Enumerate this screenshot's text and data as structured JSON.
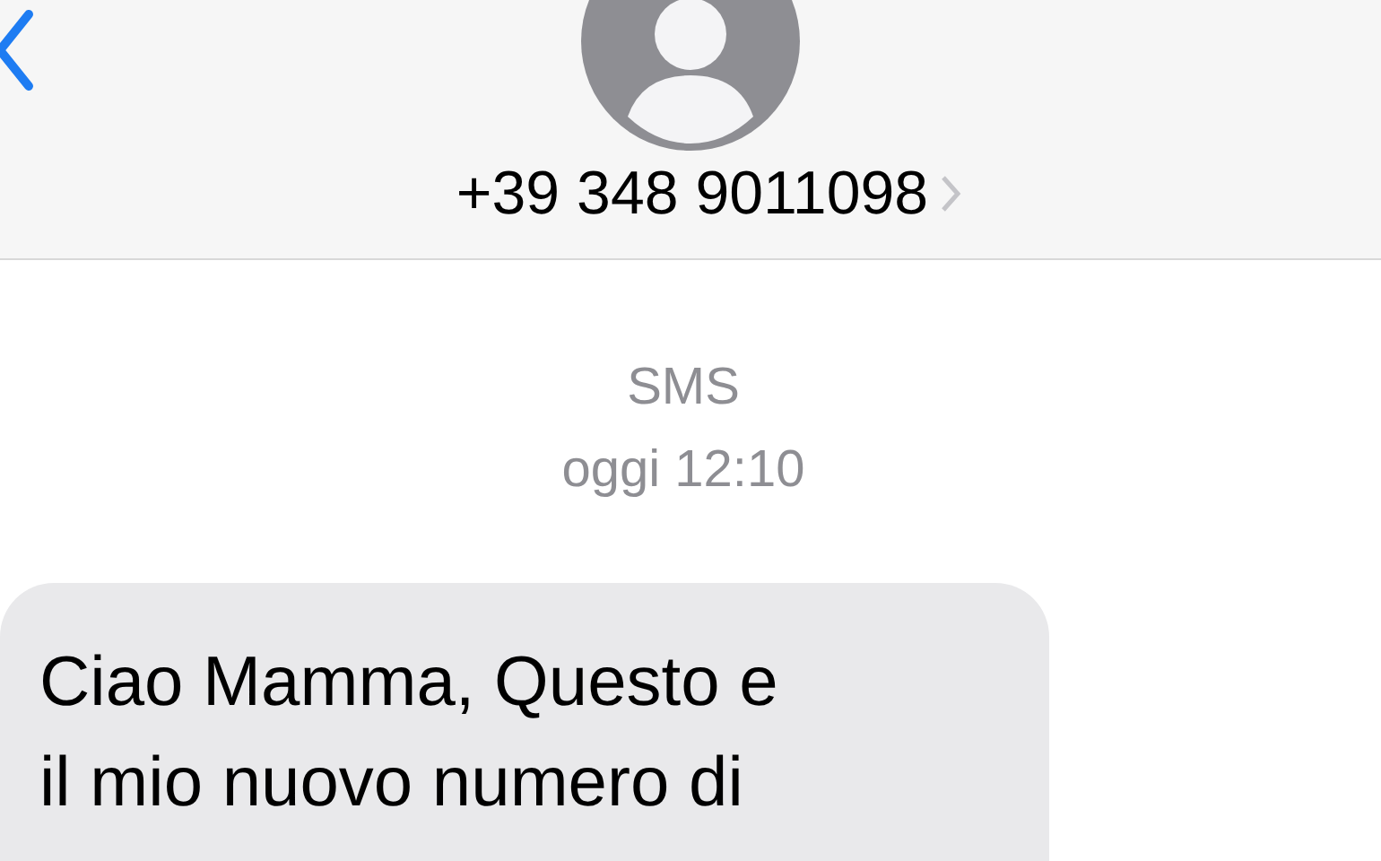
{
  "header": {
    "contact": "+39 348 9011098"
  },
  "conversation": {
    "service": "SMS",
    "timestamp": "oggi 12:10"
  },
  "message": {
    "lines": [
      "Ciao Mamma, Questo e",
      "il mio nuovo numero di"
    ]
  }
}
